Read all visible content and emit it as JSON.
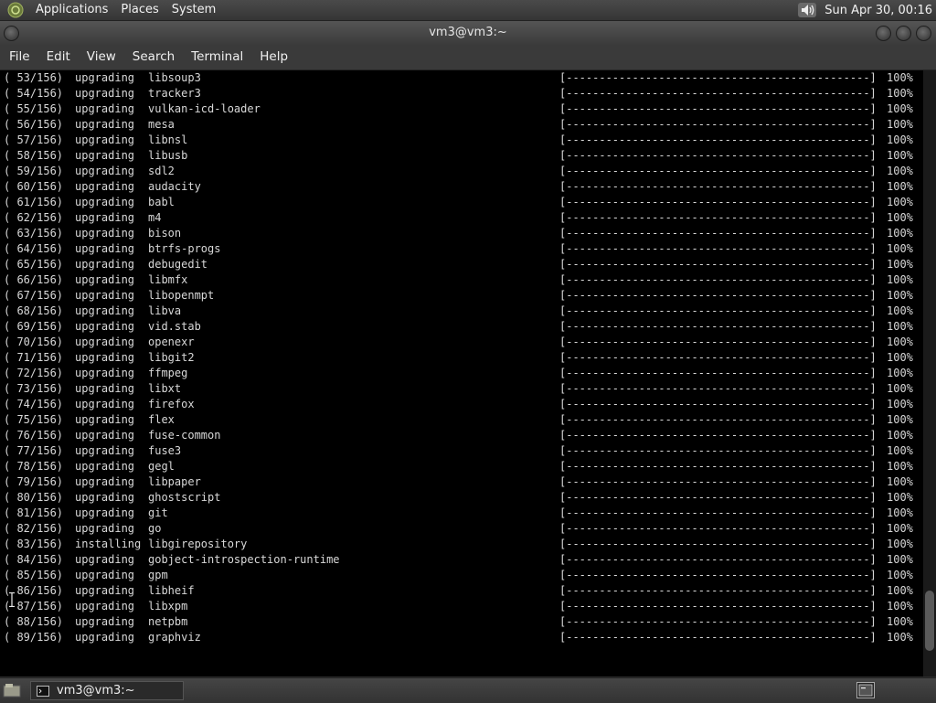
{
  "top_panel": {
    "menus": [
      "Applications",
      "Places",
      "System"
    ],
    "clock": "Sun Apr 30, 00:16",
    "icons": [
      "gnome-foot-icon",
      "volume-icon"
    ]
  },
  "window": {
    "title": "vm3@vm3:~"
  },
  "menubar": {
    "items": [
      "File",
      "Edit",
      "View",
      "Search",
      "Terminal",
      "Help"
    ]
  },
  "terminal": {
    "progress_bar": "[----------------------------------------------]",
    "lines": [
      {
        "count": "( 53/156)",
        "action": "upgrading",
        "pkg": "libsoup3",
        "pct": "100%"
      },
      {
        "count": "( 54/156)",
        "action": "upgrading",
        "pkg": "tracker3",
        "pct": "100%"
      },
      {
        "count": "( 55/156)",
        "action": "upgrading",
        "pkg": "vulkan-icd-loader",
        "pct": "100%"
      },
      {
        "count": "( 56/156)",
        "action": "upgrading",
        "pkg": "mesa",
        "pct": "100%"
      },
      {
        "count": "( 57/156)",
        "action": "upgrading",
        "pkg": "libnsl",
        "pct": "100%"
      },
      {
        "count": "( 58/156)",
        "action": "upgrading",
        "pkg": "libusb",
        "pct": "100%"
      },
      {
        "count": "( 59/156)",
        "action": "upgrading",
        "pkg": "sdl2",
        "pct": "100%"
      },
      {
        "count": "( 60/156)",
        "action": "upgrading",
        "pkg": "audacity",
        "pct": "100%"
      },
      {
        "count": "( 61/156)",
        "action": "upgrading",
        "pkg": "babl",
        "pct": "100%"
      },
      {
        "count": "( 62/156)",
        "action": "upgrading",
        "pkg": "m4",
        "pct": "100%"
      },
      {
        "count": "( 63/156)",
        "action": "upgrading",
        "pkg": "bison",
        "pct": "100%"
      },
      {
        "count": "( 64/156)",
        "action": "upgrading",
        "pkg": "btrfs-progs",
        "pct": "100%"
      },
      {
        "count": "( 65/156)",
        "action": "upgrading",
        "pkg": "debugedit",
        "pct": "100%"
      },
      {
        "count": "( 66/156)",
        "action": "upgrading",
        "pkg": "libmfx",
        "pct": "100%"
      },
      {
        "count": "( 67/156)",
        "action": "upgrading",
        "pkg": "libopenmpt",
        "pct": "100%"
      },
      {
        "count": "( 68/156)",
        "action": "upgrading",
        "pkg": "libva",
        "pct": "100%"
      },
      {
        "count": "( 69/156)",
        "action": "upgrading",
        "pkg": "vid.stab",
        "pct": "100%"
      },
      {
        "count": "( 70/156)",
        "action": "upgrading",
        "pkg": "openexr",
        "pct": "100%"
      },
      {
        "count": "( 71/156)",
        "action": "upgrading",
        "pkg": "libgit2",
        "pct": "100%"
      },
      {
        "count": "( 72/156)",
        "action": "upgrading",
        "pkg": "ffmpeg",
        "pct": "100%"
      },
      {
        "count": "( 73/156)",
        "action": "upgrading",
        "pkg": "libxt",
        "pct": "100%"
      },
      {
        "count": "( 74/156)",
        "action": "upgrading",
        "pkg": "firefox",
        "pct": "100%"
      },
      {
        "count": "( 75/156)",
        "action": "upgrading",
        "pkg": "flex",
        "pct": "100%"
      },
      {
        "count": "( 76/156)",
        "action": "upgrading",
        "pkg": "fuse-common",
        "pct": "100%"
      },
      {
        "count": "( 77/156)",
        "action": "upgrading",
        "pkg": "fuse3",
        "pct": "100%"
      },
      {
        "count": "( 78/156)",
        "action": "upgrading",
        "pkg": "gegl",
        "pct": "100%"
      },
      {
        "count": "( 79/156)",
        "action": "upgrading",
        "pkg": "libpaper",
        "pct": "100%"
      },
      {
        "count": "( 80/156)",
        "action": "upgrading",
        "pkg": "ghostscript",
        "pct": "100%"
      },
      {
        "count": "( 81/156)",
        "action": "upgrading",
        "pkg": "git",
        "pct": "100%"
      },
      {
        "count": "( 82/156)",
        "action": "upgrading",
        "pkg": "go",
        "pct": "100%"
      },
      {
        "count": "( 83/156)",
        "action": "installing",
        "pkg": "libgirepository",
        "pct": "100%"
      },
      {
        "count": "( 84/156)",
        "action": "upgrading",
        "pkg": "gobject-introspection-runtime",
        "pct": "100%"
      },
      {
        "count": "( 85/156)",
        "action": "upgrading",
        "pkg": "gpm",
        "pct": "100%"
      },
      {
        "count": "( 86/156)",
        "action": "upgrading",
        "pkg": "libheif",
        "pct": "100%"
      },
      {
        "count": "( 87/156)",
        "action": "upgrading",
        "pkg": "libxpm",
        "pct": "100%"
      },
      {
        "count": "( 88/156)",
        "action": "upgrading",
        "pkg": "netpbm",
        "pct": "100%"
      },
      {
        "count": "( 89/156)",
        "action": "upgrading",
        "pkg": "graphviz",
        "pct": "100%"
      }
    ],
    "scroll_position": 0.96,
    "scroll_visible_fraction": 0.1
  },
  "bottom_panel": {
    "task_label": "vm3@vm3:~",
    "icons": [
      "show-desktop-icon",
      "terminal-icon",
      "workspace-switcher-icon"
    ]
  },
  "colors": {
    "terminal_bg": "#000000",
    "terminal_fg": "#d8d8d8",
    "panel_bg": "#3a3a3a"
  }
}
